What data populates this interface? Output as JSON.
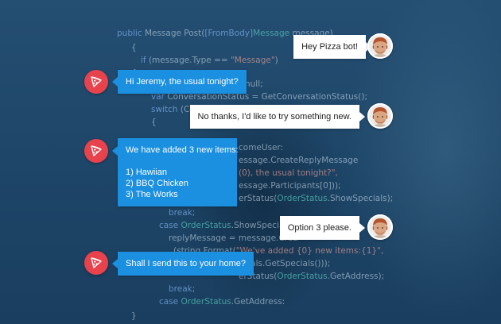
{
  "background_code": [
    {
      "parts": [
        [
          "kw",
          "public "
        ],
        [
          "t",
          "Message Post("
        ],
        [
          "kw",
          "[FromBody]"
        ],
        [
          "ty",
          "Message"
        ],
        [
          "t",
          " message)"
        ]
      ]
    },
    {
      "parts": [
        [
          "t",
          "{"
        ]
      ]
    },
    {
      "parts": [
        [
          "kw",
          "if "
        ],
        [
          "t",
          "(message.Type == "
        ],
        [
          "st",
          "\"Message\""
        ],
        [
          "t",
          ")"
        ]
      ]
    },
    {
      "parts": [
        [
          "t",
          "{"
        ]
      ]
    },
    {
      "parts": [
        [
          "t",
          "null;"
        ]
      ]
    },
    {
      "parts": [
        [
          "kw",
          "var "
        ],
        [
          "t",
          "ConversationStatus = GetConversationStatus();"
        ]
      ]
    },
    {
      "parts": [
        [
          "kw",
          "switch "
        ],
        [
          "t",
          "(ConversationStatus)"
        ]
      ]
    },
    {
      "parts": [
        [
          "t",
          "{"
        ]
      ]
    },
    {
      "parts": [
        [
          "t",
          "comeUser:"
        ]
      ]
    },
    {
      "parts": [
        [
          "t",
          "essage.CreateReplyMessage"
        ]
      ]
    },
    {
      "parts": [
        [
          "st",
          "(0), the usual tonight?\","
        ]
      ]
    },
    {
      "parts": [
        [
          "t",
          "essage.Participants[0]));"
        ]
      ]
    },
    {
      "parts": [
        [
          "t",
          "erStatus("
        ],
        [
          "ty",
          "OrderStatus"
        ],
        [
          "t",
          ".ShowSpecials);"
        ]
      ]
    },
    {
      "parts": [
        [
          "kw",
          "break;"
        ]
      ]
    },
    {
      "parts": [
        [
          "kw",
          "case "
        ],
        [
          "ty",
          "OrderStatus"
        ],
        [
          "t",
          ".ShowSpecials:"
        ]
      ]
    },
    {
      "parts": [
        [
          "t",
          "replyMessage = message.Crea"
        ]
      ]
    },
    {
      "parts": [
        [
          "t",
          "(string.Format("
        ],
        [
          "st",
          "\"We've added {0} new items:{1}\","
        ]
      ]
    },
    {
      "parts": [
        [
          "t",
          "ecials.GetSpecials()));"
        ]
      ]
    },
    {
      "parts": [
        [
          "t",
          "erStatus("
        ],
        [
          "ty",
          "OrderStatus"
        ],
        [
          "t",
          ".GetAddress);"
        ]
      ]
    },
    {
      "parts": [
        [
          "kw",
          "break;"
        ]
      ]
    },
    {
      "parts": [
        [
          "kw",
          "case "
        ],
        [
          "ty",
          "OrderStatus"
        ],
        [
          "t",
          ".GetAddress:"
        ]
      ]
    },
    {
      "parts": [
        [
          "t",
          "}"
        ]
      ]
    }
  ],
  "conversation": {
    "messages": [
      {
        "sender": "user",
        "lines": [
          "Hey Pizza bot!"
        ]
      },
      {
        "sender": "bot",
        "lines": [
          "Hi Jeremy, the usual tonight?"
        ]
      },
      {
        "sender": "user",
        "lines": [
          "No thanks, I'd like to try something new."
        ]
      },
      {
        "sender": "bot",
        "lines": [
          "We have added 3 new items:",
          "",
          "1) Hawiian",
          "2) BBQ Chicken",
          "3) The Works"
        ]
      },
      {
        "sender": "user",
        "lines": [
          "Option 3 please."
        ]
      },
      {
        "sender": "bot",
        "lines": [
          "Shall I send this to your home?"
        ]
      }
    ]
  },
  "colors": {
    "bot_bubble": "#1b8fe0",
    "bot_avatar": "#e8424c",
    "user_bubble": "#ffffff",
    "background": "#1f4a6d"
  },
  "icons": {
    "bot_avatar": "pizza-slice-icon",
    "user_avatar": "user-photo-avatar"
  }
}
